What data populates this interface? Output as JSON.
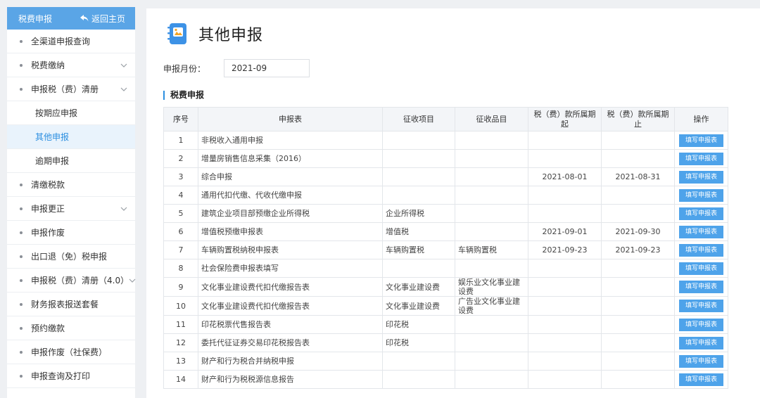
{
  "sidebar": {
    "header_title": "税费申报",
    "back_label": "返回主页",
    "items": [
      {
        "label": "全渠道申报查询",
        "chevron": false
      },
      {
        "label": "税费缴纳",
        "chevron": true
      },
      {
        "label": "申报税（费）清册",
        "chevron": true
      },
      {
        "label": "按期应申报",
        "sub": true
      },
      {
        "label": "其他申报",
        "sub": true,
        "active": true
      },
      {
        "label": "逾期申报",
        "sub": true
      },
      {
        "label": "清缴税款",
        "chevron": false
      },
      {
        "label": "申报更正",
        "chevron": true
      },
      {
        "label": "申报作废",
        "chevron": false
      },
      {
        "label": "出口退（免）税申报",
        "chevron": false
      },
      {
        "label": "申报税（费）清册（4.0）",
        "chevron": true
      },
      {
        "label": "财务报表报送套餐",
        "chevron": false
      },
      {
        "label": "预约缴款",
        "chevron": false
      },
      {
        "label": "申报作废（社保费）",
        "chevron": false
      },
      {
        "label": "申报查询及打印",
        "chevron": false
      }
    ]
  },
  "page": {
    "title": "其他申报",
    "month_label": "申报月份：",
    "month_value": "2021-09",
    "section_title": "税费申报"
  },
  "table": {
    "headers": [
      "序号",
      "申报表",
      "征收项目",
      "征收品目",
      "税（费）款所属期起",
      "税（费）款所属期止",
      "操作"
    ],
    "button_label": "填写申报表",
    "rows": [
      [
        "1",
        "非税收入通用申报",
        "",
        "",
        "",
        ""
      ],
      [
        "2",
        "增量房销售信息采集（2016）",
        "",
        "",
        "",
        ""
      ],
      [
        "3",
        "综合申报",
        "",
        "",
        "2021-08-01",
        "2021-08-31"
      ],
      [
        "4",
        "通用代扣代缴、代收代缴申报",
        "",
        "",
        "",
        ""
      ],
      [
        "5",
        "建筑企业项目部预缴企业所得税",
        "企业所得税",
        "",
        "",
        ""
      ],
      [
        "6",
        "增值税预缴申报表",
        "增值税",
        "",
        "2021-09-01",
        "2021-09-30"
      ],
      [
        "7",
        "车辆购置税纳税申报表",
        "车辆购置税",
        "车辆购置税",
        "2021-09-23",
        "2021-09-23"
      ],
      [
        "8",
        "社会保险费申报表填写",
        "",
        "",
        "",
        ""
      ],
      [
        "9",
        "文化事业建设费代扣代缴报告表",
        "文化事业建设费",
        "娱乐业文化事业建设费",
        "",
        ""
      ],
      [
        "10",
        "文化事业建设费代扣代缴报告表",
        "文化事业建设费",
        "广告业文化事业建设费",
        "",
        ""
      ],
      [
        "11",
        "印花税票代售报告表",
        "印花税",
        "",
        "",
        ""
      ],
      [
        "12",
        "委托代征证券交易印花税报告表",
        "印花税",
        "",
        "",
        ""
      ],
      [
        "13",
        "财产和行为税合并纳税申报",
        "",
        "",
        "",
        ""
      ],
      [
        "14",
        "财产和行为税税源信息报告",
        "",
        "",
        "",
        ""
      ]
    ]
  },
  "colors": {
    "accent": "#2d8fe0",
    "sidebar_header": "#5aa5e6",
    "button": "#4ea3ea"
  }
}
